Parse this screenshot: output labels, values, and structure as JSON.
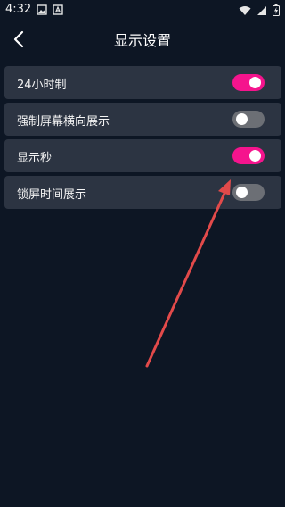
{
  "status_bar": {
    "time": "4:32"
  },
  "header": {
    "title": "显示设置"
  },
  "settings": [
    {
      "label": "24小时制",
      "on": true
    },
    {
      "label": "强制屏幕横向展示",
      "on": false
    },
    {
      "label": "显示秒",
      "on": true
    },
    {
      "label": "锁屏时间展示",
      "on": false
    }
  ],
  "colors": {
    "background": "#0d1624",
    "row": "#2c3442",
    "toggle_on": "#f5148d",
    "toggle_off": "#6c6f75",
    "annotation_arrow": "#e24a4a"
  }
}
